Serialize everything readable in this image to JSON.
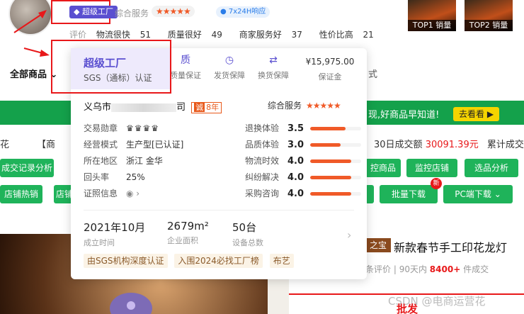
{
  "header": {
    "super_badge": "超级工厂",
    "service_label": "综合服务",
    "service_stars": "★★★★★",
    "response_pill": "7x24H响应",
    "ratings": [
      {
        "label": "评价",
        "value": ""
      },
      {
        "label": "物流很快",
        "value": "51"
      },
      {
        "label": "质量很好",
        "value": "49"
      },
      {
        "label": "商家服务好",
        "value": "37"
      },
      {
        "label": "性价比高",
        "value": "21"
      }
    ],
    "top_tags": [
      "TOP1 销量",
      "TOP2 销量"
    ]
  },
  "nav": {
    "all_goods": "全部商品",
    "left_fragments": [
      "花",
      "【商",
      "成交记录分析",
      "店铺热销",
      "店铺"
    ],
    "right_fragment": "式"
  },
  "right_panel": {
    "news": "现,好商品早知道!",
    "look_btn": "去看看 ▶",
    "stats": [
      {
        "label": "30日成交额",
        "value": "30091.39元"
      },
      {
        "label": "累计成交",
        "value": ""
      }
    ],
    "row1_buttons": [
      "控商品",
      "监控店铺",
      "选品分析"
    ],
    "row2_buttons": [
      "批量下载",
      "PC端下载"
    ],
    "new_badge": "新",
    "product_tag": "之宝",
    "product_title": "新款春节手工印花龙灯",
    "eval_prefix": "条评价",
    "eval_sold_label": "90天内",
    "eval_sold_value": "8400+",
    "eval_sold_unit": "件成交",
    "pifa": "批发",
    "watermark": "CSDN @电商运营花"
  },
  "popup": {
    "super_title": "超级工厂",
    "sgs": "SGS（通标）认证",
    "guarantees": [
      {
        "icon": "quality-icon",
        "glyph": "质",
        "label": "质量保证"
      },
      {
        "icon": "clock-icon",
        "glyph": "◷",
        "label": "发货保障"
      },
      {
        "icon": "exchange-icon",
        "glyph": "⇄",
        "label": "换货保障"
      }
    ],
    "deposit_amount": "¥15,975.00",
    "deposit_label": "保证金",
    "shop_prefix": "义乌市",
    "shop_suffix": "司",
    "years_prefix": "诚",
    "years": "8年",
    "service_label": "综合服务",
    "service_stars": "★★★★★",
    "info": [
      {
        "key": "交易勋章",
        "value": "♛♛♛♛"
      },
      {
        "key": "经营模式",
        "value": "生产型[已认证]"
      },
      {
        "key": "所在地区",
        "value": "浙江 金华"
      },
      {
        "key": "回头率",
        "value": "25%"
      },
      {
        "key": "证照信息",
        "value": "◉ ›"
      }
    ],
    "scores": [
      {
        "key": "退换体验",
        "value": "3.5",
        "level": 0.7
      },
      {
        "key": "品质体验",
        "value": "3.0",
        "level": 0.6
      },
      {
        "key": "物流时效",
        "value": "4.0",
        "level": 0.8
      },
      {
        "key": "纠纷解决",
        "value": "4.0",
        "level": 0.8
      },
      {
        "key": "采购咨询",
        "value": "4.0",
        "level": 0.8
      }
    ],
    "metrics": [
      {
        "big": "2021年10月",
        "small": "成立时间"
      },
      {
        "big": "2679m²",
        "small": "企业面积"
      },
      {
        "big": "50台",
        "small": "设备总数"
      }
    ],
    "tags": [
      "由SGS机构深度认证",
      "入围2024必找工厂榜",
      "布艺"
    ]
  }
}
